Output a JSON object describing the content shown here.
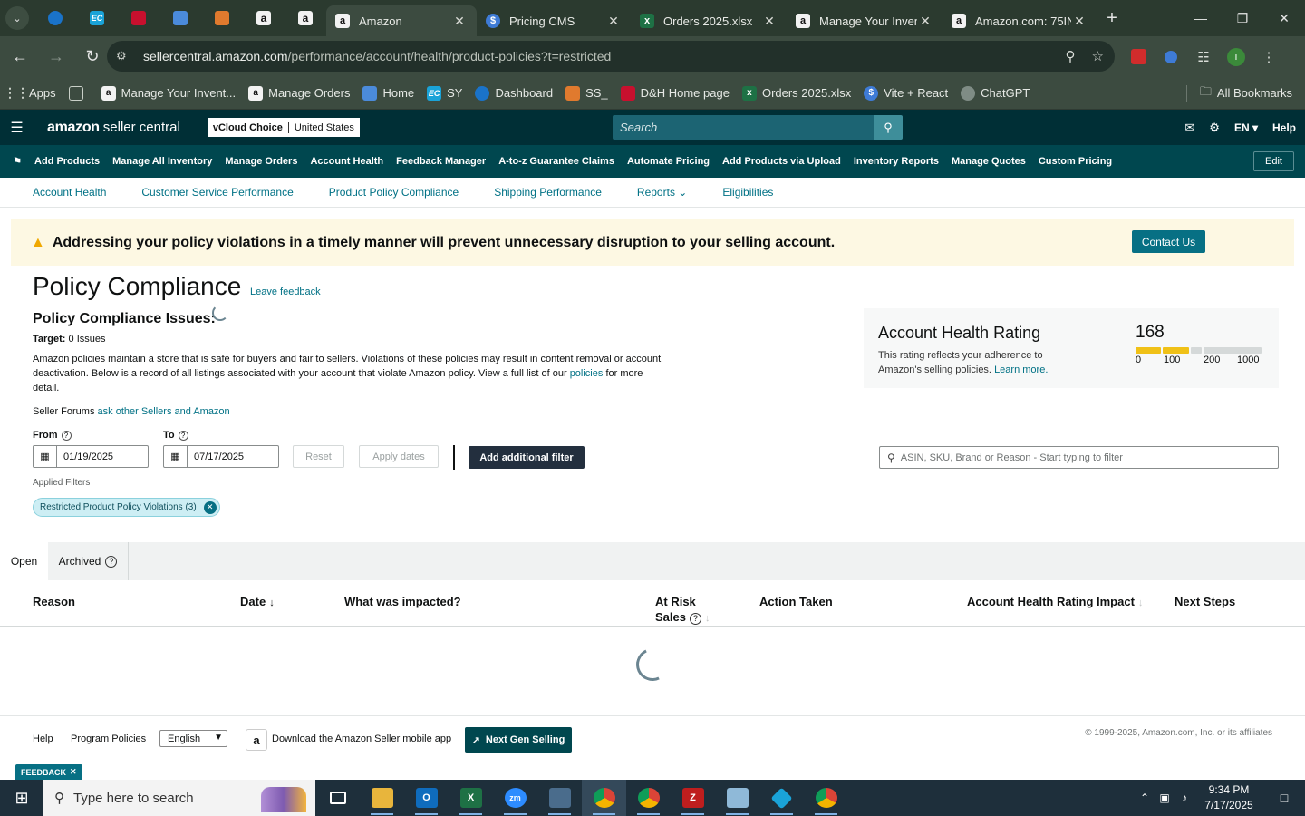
{
  "browser": {
    "pinned_tabs": [
      {
        "icon": "circle-app-icon",
        "color": "#1a73c9"
      },
      {
        "icon": "ec-icon",
        "color": "#1aa3d8"
      },
      {
        "icon": "dh-icon",
        "color": "#c8102e"
      },
      {
        "icon": "g-icon",
        "color": "#4b8bdb"
      },
      {
        "icon": "box-icon",
        "color": "#e07a2e"
      },
      {
        "icon": "amazon-icon",
        "color": "#111111"
      },
      {
        "icon": "amazon-icon",
        "color": "#111111"
      }
    ],
    "tabs": [
      {
        "title": "Amazon",
        "icon": "amazon-icon",
        "active": true,
        "icon_letter": "a",
        "color": "#111111"
      },
      {
        "title": "Pricing CMS",
        "icon": "dollar-icon",
        "active": false,
        "icon_letter": "$",
        "color": "#3e7bd6"
      },
      {
        "title": "Orders 2025.xlsx",
        "icon": "excel-icon",
        "active": false,
        "icon_letter": "x",
        "color": "#1e7145"
      },
      {
        "title": "Manage Your Inven",
        "icon": "amazon-icon",
        "active": false,
        "icon_letter": "a",
        "color": "#111111"
      },
      {
        "title": "Amazon.com: 75IN",
        "icon": "amazon-icon",
        "active": false,
        "icon_letter": "a",
        "color": "#111111"
      }
    ],
    "url_host": "sellercentral.amazon.com",
    "url_path": "/performance/account/health/product-policies?t=restricted",
    "bookmarks": [
      {
        "label": "Apps",
        "icon": "apps-grid-icon",
        "color": "#4a73c9"
      },
      {
        "label": "",
        "icon": "grid-icon",
        "color": "#6b776e"
      },
      {
        "label": "Manage Your Invent...",
        "icon": "amazon-icon",
        "color": "#111111"
      },
      {
        "label": "Manage Orders",
        "icon": "amazon-icon",
        "color": "#111111"
      },
      {
        "label": "Home",
        "icon": "g-icon",
        "color": "#4b8bdb"
      },
      {
        "label": "SY",
        "icon": "ec-icon",
        "color": "#1aa3d8"
      },
      {
        "label": "Dashboard",
        "icon": "circle-app-icon",
        "color": "#1a73c9"
      },
      {
        "label": "SS_",
        "icon": "box-icon",
        "color": "#e07a2e"
      },
      {
        "label": "D&H Home page",
        "icon": "dh-icon",
        "color": "#c8102e"
      },
      {
        "label": "Orders 2025.xlsx",
        "icon": "excel-icon",
        "color": "#1e7145"
      },
      {
        "label": "Vite + React",
        "icon": "dollar-icon",
        "color": "#3e7bd6"
      },
      {
        "label": "ChatGPT",
        "icon": "chatgpt-icon",
        "color": "#7f8c85"
      }
    ],
    "all_bookmarks": "All Bookmarks",
    "profile_letter": "i"
  },
  "seller": {
    "logo_text": "amazon",
    "logo_suffix": "seller central",
    "store_name": "vCloud Choice",
    "marketplace": "United States",
    "search_placeholder": "Search",
    "lang": "EN",
    "help": "Help",
    "nav": [
      "Add Products",
      "Manage All Inventory",
      "Manage Orders",
      "Account Health",
      "Feedback Manager",
      "A-to-z Guarantee Claims",
      "Automate Pricing",
      "Add Products via Upload",
      "Inventory Reports",
      "Manage Quotes",
      "Custom Pricing"
    ],
    "edit": "Edit",
    "subnav": [
      "Account Health",
      "Customer Service Performance",
      "Product Policy Compliance",
      "Shipping Performance",
      "Reports",
      "Eligibilities"
    ]
  },
  "alert": {
    "message": "Addressing your policy violations in a timely manner will prevent unnecessary disruption to your selling account.",
    "button": "Contact Us"
  },
  "page": {
    "title": "Policy Compliance",
    "leave_feedback": "Leave feedback",
    "issues_heading": "Policy Compliance Issues:",
    "target_label": "Target:",
    "target_value": "0 Issues",
    "description_1": "Amazon policies maintain a store that is safe for buyers and fair to sellers. Violations of these policies may result in content removal or account deactivation. Below is a record of all listings associated with your account that violate Amazon policy. View a full list of our",
    "policies_link": "policies",
    "description_2": "for more detail.",
    "forums_prefix": "Seller Forums",
    "forums_link": "ask other Sellers and Amazon"
  },
  "ahr": {
    "title": "Account Health Rating",
    "subtitle": "This rating reflects your adherence to Amazon's selling policies.",
    "learn_more": "Learn more.",
    "score": "168",
    "ticks": [
      "0",
      "100",
      "200",
      "1000"
    ],
    "colors": {
      "filled": "#f0c117",
      "empty": "#d5d9d9"
    }
  },
  "filters": {
    "from_label": "From",
    "to_label": "To",
    "from_date": "01/19/2025",
    "to_date": "07/17/2025",
    "reset": "Reset",
    "apply": "Apply dates",
    "add_filter": "Add additional filter",
    "search_placeholder": "ASIN, SKU, Brand or Reason - Start typing to filter",
    "applied_label": "Applied Filters",
    "chip": "Restricted Product Policy Violations (3)"
  },
  "tabs": {
    "open": "Open",
    "archived": "Archived"
  },
  "table": {
    "headers": [
      "Reason",
      "Date",
      "What was impacted?",
      "At Risk",
      "Sales",
      "Action Taken",
      "Account Health Rating Impact",
      "Next Steps"
    ]
  },
  "footer": {
    "help": "Help",
    "program_policies": "Program Policies",
    "language": "English",
    "download_app": "Download the Amazon Seller mobile app",
    "next_gen": "Next Gen Selling",
    "copyright": "© 1999-2025, Amazon.com, Inc. or its affiliates",
    "feedback": "FEEDBACK"
  },
  "taskbar": {
    "search_placeholder": "Type here to search",
    "apps": [
      {
        "icon": "task-view-icon",
        "color": "#1e2f3b"
      },
      {
        "icon": "file-explorer-icon",
        "color": "#e8b53c"
      },
      {
        "icon": "outlook-icon",
        "color": "#0f6cbd"
      },
      {
        "icon": "excel-icon",
        "color": "#1e7145"
      },
      {
        "icon": "zoom-icon",
        "color": "#2d8cff"
      },
      {
        "icon": "calculator-icon",
        "color": "#4a6c8c"
      },
      {
        "icon": "chrome-icon",
        "color": "#3aa55c"
      },
      {
        "icon": "chrome-icon",
        "color": "#3aa55c"
      },
      {
        "icon": "filezilla-icon",
        "color": "#bf1e1e"
      },
      {
        "icon": "notes-icon",
        "color": "#8fb9d8"
      },
      {
        "icon": "app-diamond-icon",
        "color": "#1aa3d8"
      },
      {
        "icon": "chrome-profile-icon",
        "color": "#3aa55c"
      }
    ],
    "time": "9:34 PM",
    "date": "7/17/2025"
  }
}
